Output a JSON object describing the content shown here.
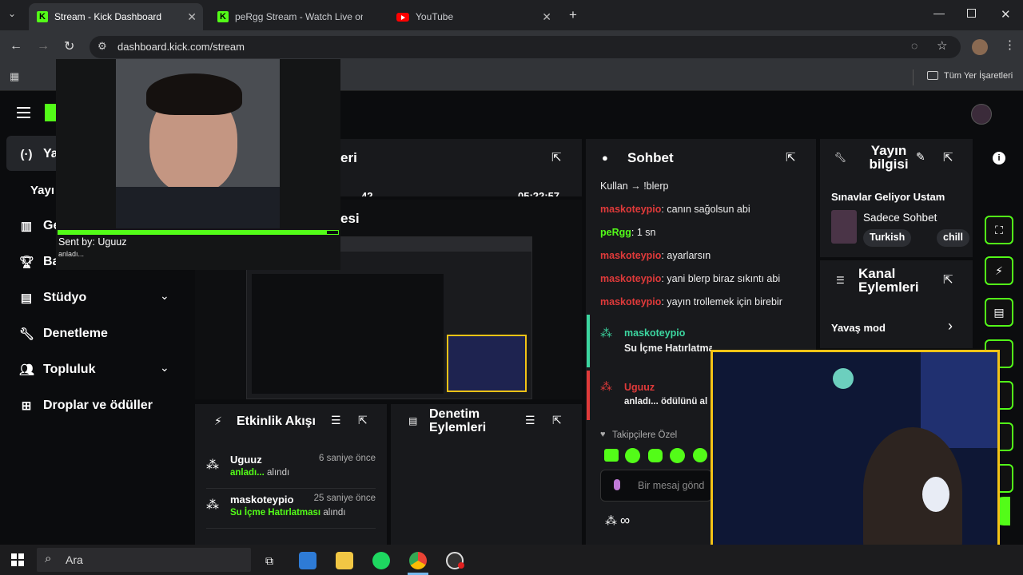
{
  "browser": {
    "tabs": [
      {
        "label": "Stream - Kick Dashboard",
        "active": true
      },
      {
        "label": "peRgg Stream - Watch Live on K"
      },
      {
        "label": "YouTube"
      }
    ],
    "url": "dashboard.kick.com/stream",
    "bookmarks_label": "Tüm Yer İşaretleri"
  },
  "alert": {
    "sent_by": "Sent by: Uguuz",
    "message": "anladı..."
  },
  "sidebar": {
    "items": [
      {
        "label": "Ya",
        "icon": "broadcast-icon"
      },
      {
        "label": "Yayı",
        "icon": ""
      },
      {
        "label": "Ge",
        "icon": "chart-icon"
      },
      {
        "label": "Ba",
        "icon": "trophy-icon"
      },
      {
        "label": "Stüdyo",
        "icon": "studio-icon"
      },
      {
        "label": "Denetleme",
        "icon": "wrench-icon"
      },
      {
        "label": "Topluluk",
        "icon": "people-icon"
      },
      {
        "label": "Droplar ve ödüller",
        "icon": "gift-icon"
      }
    ]
  },
  "stats": {
    "title_fragment": "eri",
    "viewers": "42",
    "duration": "05:22:57",
    "preview_title_fragment": "esi"
  },
  "activity": {
    "title": "Etkinlik Akışı",
    "items": [
      {
        "user": "Uguuz",
        "time": "6 saniye önce",
        "reward": "anladı...",
        "suffix": "alındı"
      },
      {
        "user": "maskoteypio",
        "time": "25 saniye önce",
        "reward": "Su İçme Hatırlatması",
        "suffix": "alındı"
      }
    ]
  },
  "moderation": {
    "title": "Denetim Eylemleri"
  },
  "chat": {
    "title": "Sohbet",
    "messages": [
      {
        "user": "Kullan",
        "text": "→ !blerp",
        "color": "#e8e9ea"
      },
      {
        "user": "maskoteypio",
        "text": ": canın sağolsun abi",
        "color": "#e03a3a"
      },
      {
        "user": "peRgg",
        "text": ": 1 sn",
        "color": "#53fc18"
      },
      {
        "user": "maskoteypio",
        "text": ": ayarlarsın",
        "color": "#e03a3a"
      },
      {
        "user": "maskoteypio",
        "text": ": yani blerp biraz sıkıntı abi",
        "color": "#e03a3a"
      },
      {
        "user": "maskoteypio",
        "text": ": yayın trollemek için birebir",
        "color": "#e03a3a"
      }
    ],
    "reward_events": [
      {
        "user": "maskoteypio",
        "text": "Su İçme Hatırlatması ödülünü aldı",
        "color": "#3cd6a0"
      },
      {
        "user": "Uguuz",
        "text": "anladı... ödülünü al",
        "color": "#e03a3a"
      }
    ],
    "followers_only": "Takipçilere Özel",
    "input_placeholder": "Bir mesaj gönd"
  },
  "stream_info": {
    "title": "Yayın bilgisi",
    "stream_title": "Sınavlar Geliyor Ustam",
    "category": "Sadece Sohbet",
    "tags": [
      "Turkish",
      "chill"
    ]
  },
  "channel_actions": {
    "title": "Kanal Eylemleri",
    "slow_mode": "Yavaş mod"
  },
  "webcam": {
    "badge_count": "5"
  },
  "taskbar": {
    "search": "Ara"
  },
  "colors": {
    "accent": "#53fc18",
    "panel": "#18191c",
    "background": "#0b0c0e"
  }
}
